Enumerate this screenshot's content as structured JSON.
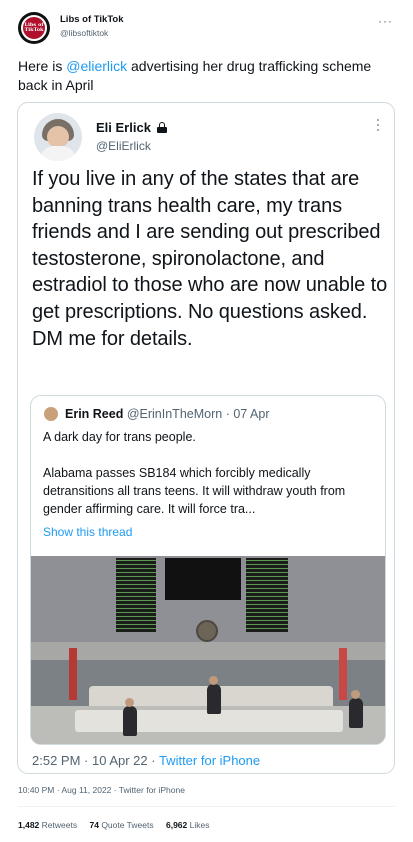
{
  "author": {
    "name": "Libs of TikTok",
    "handle": "@libsoftiktok",
    "avatar_text": "Libs of TikTok"
  },
  "tweet": {
    "prefix": "Here is ",
    "mention": "@elierlick",
    "suffix": " advertising her drug trafficking scheme back in April"
  },
  "embedded": {
    "name": "Eli Erlick",
    "handle": "@EliErlick",
    "text": "If you live in any of the states that are banning trans health care, my trans friends and I are sending out prescribed testosterone, spironolactone, and estradiol to those who are now unable to get prescriptions. No questions asked. DM me for details.",
    "quote": {
      "name": "Erin Reed",
      "handle": "@ErinInTheMorn",
      "date": "· 07 Apr",
      "line1": "A dark day for trans people.",
      "line2": "Alabama passes SB184 which forcibly medically detransitions all trans teens. It will withdraw youth from gender affirming care. It will force tra...",
      "show_thread": "Show this thread"
    },
    "time": "2:52 PM · 10 Apr 22 · ",
    "via": "Twitter for iPhone"
  },
  "meta": {
    "timestamp": "10:40 PM · Aug 11, 2022 · Twitter for iPhone"
  },
  "stats": {
    "retweets_count": "1,482",
    "retweets_label": "Retweets",
    "quotes_count": "74",
    "quotes_label": "Quote Tweets",
    "likes_count": "6,962",
    "likes_label": "Likes"
  },
  "icons": {
    "more": "more-icon",
    "lock": "lock-icon"
  },
  "colors": {
    "link": "#1d9bf0",
    "secondary_text": "#536471",
    "border": "#cfd9de"
  }
}
